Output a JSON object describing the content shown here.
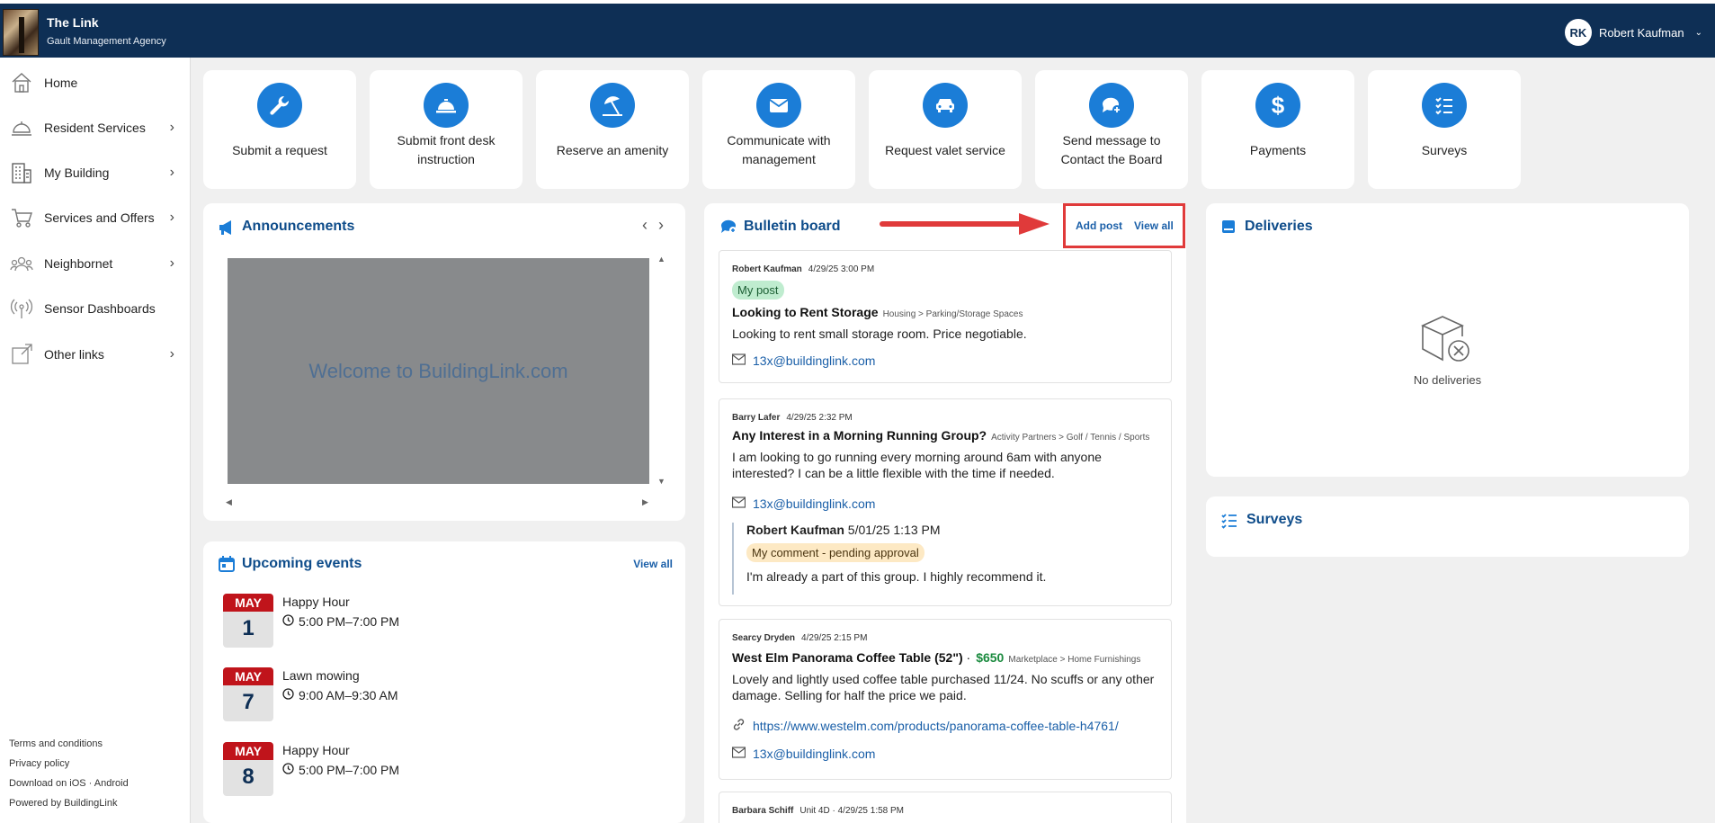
{
  "header": {
    "app_name": "The Link",
    "agency": "Gault Management Agency",
    "user_initials": "RK",
    "user_name": "Robert Kaufman"
  },
  "sidebar": {
    "items": [
      {
        "label": "Home",
        "icon": "home-icon"
      },
      {
        "label": "Resident Services",
        "icon": "concierge-bell-icon"
      },
      {
        "label": "My Building",
        "icon": "building-icon"
      },
      {
        "label": "Services and Offers",
        "icon": "shopping-cart-icon"
      },
      {
        "label": "Neighbornet",
        "icon": "people-icon"
      },
      {
        "label": "Sensor Dashboards",
        "icon": "sensor-icon"
      },
      {
        "label": "Other links",
        "icon": "external-link-icon"
      }
    ],
    "footer": {
      "terms": "Terms and conditions",
      "privacy": "Privacy policy",
      "download": "Download on iOS · Android",
      "powered": "Powered by BuildingLink"
    }
  },
  "tiles": [
    {
      "label": "Submit a request",
      "icon": "wrench-icon"
    },
    {
      "label": "Submit front desk instruction",
      "icon": "service-bell-icon"
    },
    {
      "label": "Reserve an amenity",
      "icon": "umbrella-beach-icon"
    },
    {
      "label": "Communicate with management",
      "icon": "envelope-icon"
    },
    {
      "label": "Request valet service",
      "icon": "car-icon"
    },
    {
      "label": "Send message to Contact the Board",
      "icon": "chat-plus-icon"
    },
    {
      "label": "Payments",
      "icon": "dollar-icon"
    },
    {
      "label": "Surveys",
      "icon": "checklist-icon"
    }
  ],
  "announcements": {
    "title": "Announcements",
    "slide_text": "Welcome to BuildingLink.com"
  },
  "events": {
    "title": "Upcoming events",
    "view_all": "View all",
    "items": [
      {
        "month": "MAY",
        "day": "1",
        "title": "Happy Hour",
        "time": "5:00 PM–7:00 PM"
      },
      {
        "month": "MAY",
        "day": "7",
        "title": "Lawn mowing",
        "time": "9:00 AM–9:30 AM"
      },
      {
        "month": "MAY",
        "day": "8",
        "title": "Happy Hour",
        "time": "5:00 PM–7:00 PM"
      }
    ]
  },
  "bulletin": {
    "title": "Bulletin board",
    "add_post": "Add post",
    "view_all": "View all",
    "posts": [
      {
        "author": "Robert Kaufman",
        "date": "4/29/25 3:00 PM",
        "badge": "My post",
        "title": "Looking to Rent Storage",
        "category": "Housing > Parking/Storage Spaces",
        "body": "Looking to rent small storage room. Price negotiable.",
        "email": "13x@buildinglink.com"
      },
      {
        "author": "Barry Lafer",
        "date": "4/29/25 2:32 PM",
        "title": "Any Interest in a Morning Running Group?",
        "category": "Activity Partners > Golf / Tennis / Sports",
        "body": "I am looking to go running every morning around 6am with anyone interested? I can be a little flexible with the time if needed.",
        "email": "13x@buildinglink.com",
        "reply": {
          "author": "Robert Kaufman",
          "date": "5/01/25 1:13 PM",
          "badge": "My comment - pending approval",
          "body": "I'm already a part of this group. I highly recommend it."
        }
      },
      {
        "author": "Searcy Dryden",
        "date": "4/29/25 2:15 PM",
        "title": "West Elm Panorama Coffee Table (52\")",
        "price": "$650",
        "category": "Marketplace > Home Furnishings",
        "body": "Lovely and lightly used coffee table purchased 11/24. No scuffs or any other damage. Selling for half the price we paid.",
        "url": "https://www.westelm.com/products/panorama-coffee-table-h4761/",
        "email": "13x@buildinglink.com"
      },
      {
        "author": "Barbara Schiff",
        "unit": "Unit 4D",
        "date": "4/29/25 1:58 PM"
      }
    ]
  },
  "deliveries": {
    "title": "Deliveries",
    "empty": "No deliveries"
  },
  "surveys": {
    "title": "Surveys"
  },
  "colors": {
    "header_bg": "#0e2f55",
    "accent_blue": "#1b7dd7",
    "event_red": "#c0141b",
    "annotation_red": "#e03a3a"
  }
}
